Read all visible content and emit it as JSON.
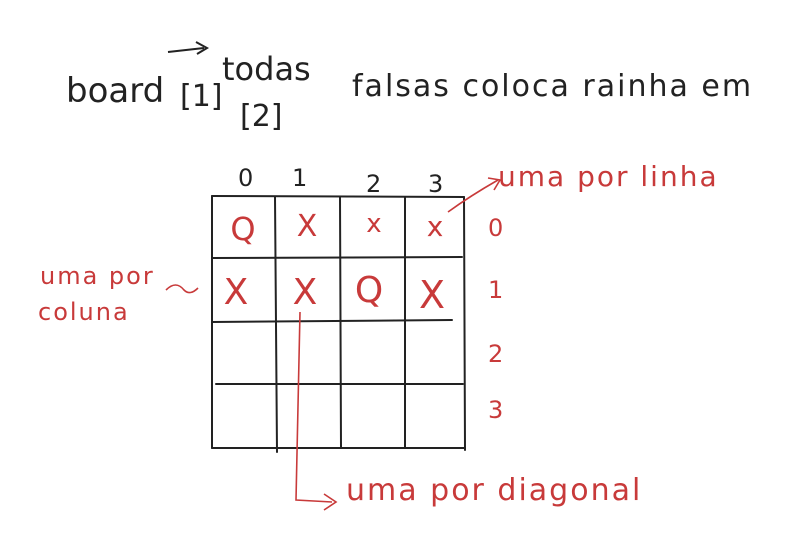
{
  "heading": {
    "prefix": "board",
    "index_1": "[1]",
    "index_2": "[2]",
    "note_above": "todas",
    "rest": "falsas coloca rainha em"
  },
  "colors": {
    "ink": "#222222",
    "red": "#c83a3a"
  },
  "board": {
    "columns": [
      "0",
      "1",
      "2",
      "3"
    ],
    "rows": [
      "0",
      "1",
      "2",
      "3"
    ],
    "cells": [
      [
        "Q",
        "X",
        "x",
        "x"
      ],
      [
        "X",
        "X",
        "Q",
        "X"
      ],
      [
        "",
        "",
        "",
        ""
      ],
      [
        "",
        "",
        "",
        ""
      ]
    ]
  },
  "annotations": {
    "row_rule": "uma por linha",
    "column_rule_line1": "uma por",
    "column_rule_line2": "coluna",
    "diagonal_rule": "uma por diagonal"
  }
}
